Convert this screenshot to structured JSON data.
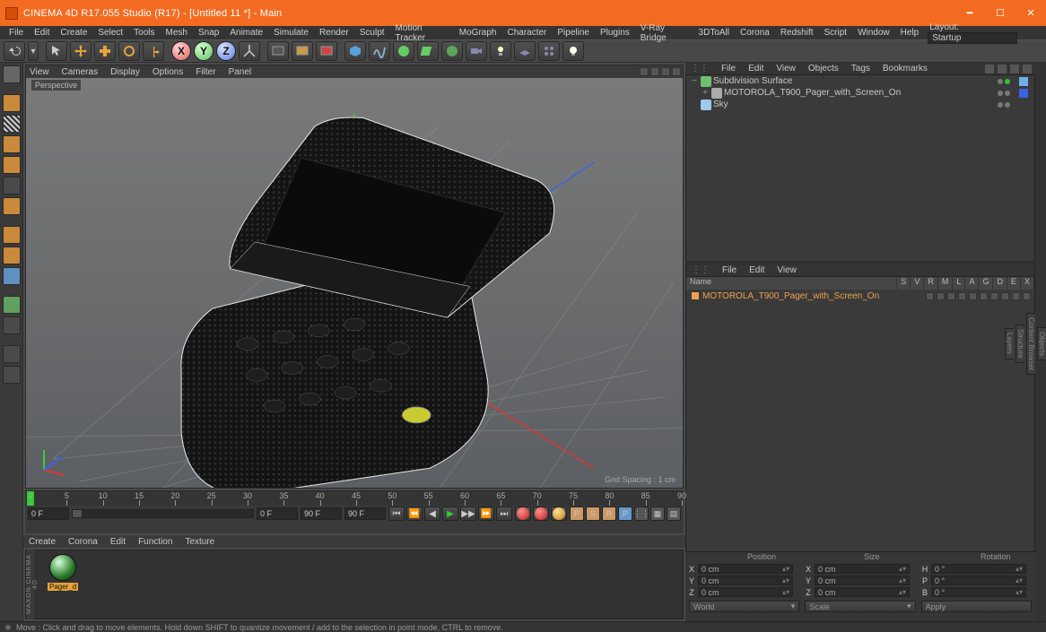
{
  "app": {
    "title": "CINEMA 4D R17.055 Studio (R17) - [Untitled 11 *] - Main",
    "layout_label": "Layout:",
    "layout_value": "Startup"
  },
  "menus": [
    "File",
    "Edit",
    "Create",
    "Select",
    "Tools",
    "Mesh",
    "Snap",
    "Animate",
    "Simulate",
    "Render",
    "Sculpt",
    "Motion Tracker",
    "MoGraph",
    "Character",
    "Pipeline",
    "Plugins",
    "V-Ray Bridge",
    "3DToAll",
    "Corona",
    "Redshift",
    "Script",
    "Window",
    "Help"
  ],
  "axes": {
    "x": "X",
    "y": "Y",
    "z": "Z"
  },
  "viewport": {
    "menu": [
      "View",
      "Cameras",
      "Display",
      "Options",
      "Filter",
      "Panel"
    ],
    "mode": "Perspective",
    "grid_label": "Grid Spacing : 1 cm"
  },
  "timeline": {
    "ticks": [
      0,
      5,
      10,
      15,
      20,
      25,
      30,
      35,
      40,
      45,
      50,
      55,
      60,
      65,
      70,
      75,
      80,
      85,
      90
    ],
    "start": "0 F",
    "cur": "0 F",
    "end": "90 F",
    "endb": "90 F",
    "key_letters": [
      "P",
      "S",
      "R",
      "P"
    ]
  },
  "materials": {
    "menu": [
      "Create",
      "Corona",
      "Edit",
      "Function",
      "Texture"
    ],
    "items": [
      {
        "label": "Pager_d"
      }
    ],
    "brand": "MAXON CINEMA 4D"
  },
  "object_manager": {
    "menu": [
      "File",
      "Edit",
      "View",
      "Objects",
      "Tags",
      "Bookmarks"
    ],
    "tree": [
      {
        "indent": 0,
        "exp": "−",
        "icon": "subdiv",
        "name": "Subdivision Surface",
        "dotA": "#7a7a7a",
        "dotB": "#31c431",
        "tag": "#6fb0e8"
      },
      {
        "indent": 1,
        "exp": "+",
        "icon": "null",
        "name": "MOTOROLA_T900_Pager_with_Screen_On",
        "dotA": "#7a7a7a",
        "dotB": "#7a7a7a",
        "tag": "#3a62e0"
      },
      {
        "indent": 0,
        "exp": "",
        "icon": "sky",
        "name": "Sky",
        "dotA": "#7a7a7a",
        "dotB": "#7a7a7a",
        "tag": ""
      }
    ]
  },
  "take_manager": {
    "menu": [
      "File",
      "Edit",
      "View"
    ],
    "columns": [
      "Name",
      "S",
      "V",
      "R",
      "M",
      "L",
      "A",
      "G",
      "D",
      "E",
      "X"
    ],
    "take": "MOTOROLA_T900_Pager_with_Screen_On",
    "name_label": "Name"
  },
  "coords": {
    "headers": [
      "",
      "Position",
      "",
      "Size",
      "",
      "Rotation"
    ],
    "axes": [
      "X",
      "Y",
      "Z"
    ],
    "p": [
      "0 cm",
      "0 cm",
      "0 cm"
    ],
    "slab": [
      "X",
      "Y",
      "Z"
    ],
    "s": [
      "0 cm",
      "0 cm",
      "0 cm"
    ],
    "rlab": [
      "H",
      "P",
      "B"
    ],
    "r": [
      "0 °",
      "0 °",
      "0 °"
    ],
    "dd1": "World",
    "dd2": "Scale",
    "apply": "Apply"
  },
  "status": "Move : Click and drag to move elements. Hold down SHIFT to quantize movement / add to the selection in point mode, CTRL to remove.",
  "right_tabs": [
    "Objects",
    "Content Browser",
    "Structure",
    "Layers"
  ]
}
